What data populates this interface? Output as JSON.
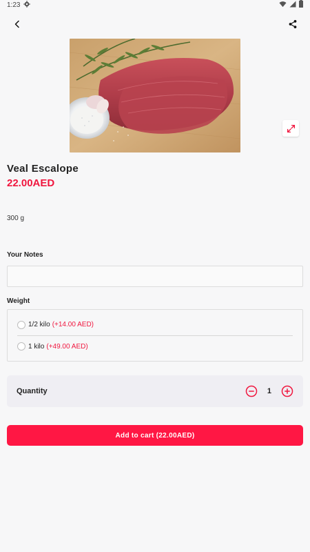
{
  "status_bar": {
    "time": "1:23"
  },
  "product": {
    "name": "Veal Escalope",
    "price": "22.00AED",
    "description": "300 g"
  },
  "notes": {
    "label": "Your Notes",
    "value": "",
    "placeholder": ""
  },
  "weight": {
    "label": "Weight",
    "options": [
      {
        "label": "1/2 kilo",
        "extra": "(+14.00 AED)"
      },
      {
        "label": "1 kilo",
        "extra": "(+49.00 AED)"
      }
    ]
  },
  "quantity": {
    "label": "Quantity",
    "value": "1"
  },
  "cart": {
    "button_label": "Add to cart (22.00AED)"
  },
  "colors": {
    "accent": "#ff1744",
    "price": "#f0163e"
  },
  "icons": [
    "settings-icon",
    "wifi-icon",
    "signal-icon",
    "battery-icon",
    "back-icon",
    "share-icon",
    "expand-icon",
    "minus-icon",
    "plus-icon"
  ]
}
